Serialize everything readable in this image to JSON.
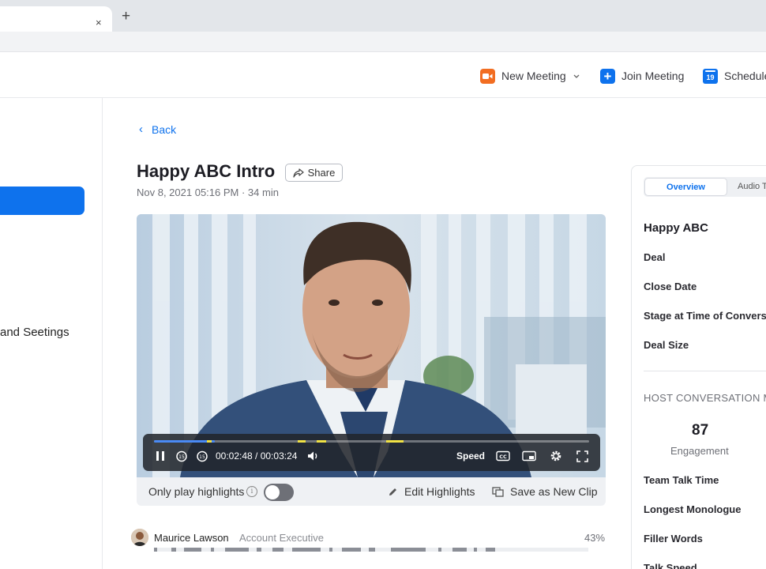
{
  "browser": {
    "tab_close": "×",
    "new_tab": "+"
  },
  "header": {
    "new_meeting": "New Meeting",
    "join_meeting": "Join Meeting",
    "join_icon_glyph": "+",
    "schedule": "Schedule",
    "schedule_icon_day": "19"
  },
  "sidebar": {
    "settings_label": "and Seetings"
  },
  "main": {
    "back": "Back",
    "back_glyph": "‹",
    "title": "Happy ABC Intro",
    "share": "Share",
    "meta": "Nov 8, 2021 05:16 PM · 34 min"
  },
  "player": {
    "time": "00:02:48 / 00:03:24",
    "speed": "Speed",
    "progress": 0.14,
    "skip_seconds": "15"
  },
  "highlights": {
    "only_play": "Only play highlights",
    "info_glyph": "i",
    "toggle_on": false,
    "edit": "Edit Highlights",
    "save_clip": "Save as New Clip"
  },
  "speaker": {
    "name": "Maurice Lawson",
    "role": "Account Executive",
    "percent": "43%"
  },
  "panel": {
    "tabs": [
      "Overview",
      "Audio T"
    ],
    "deal_title": "Happy ABC",
    "fields": [
      "Deal",
      "Close Date",
      "Stage at Time of Convers",
      "Deal Size"
    ],
    "section_title": "HOST CONVERSATION M",
    "score": "87",
    "score_label": "Engagement",
    "metrics": [
      "Team Talk Time",
      "Longest Monologue",
      "Filler Words",
      "Talk Speed"
    ]
  },
  "colors": {
    "accent": "#0e72ed",
    "orange": "#f26d21",
    "highlight": "#f0e245"
  }
}
